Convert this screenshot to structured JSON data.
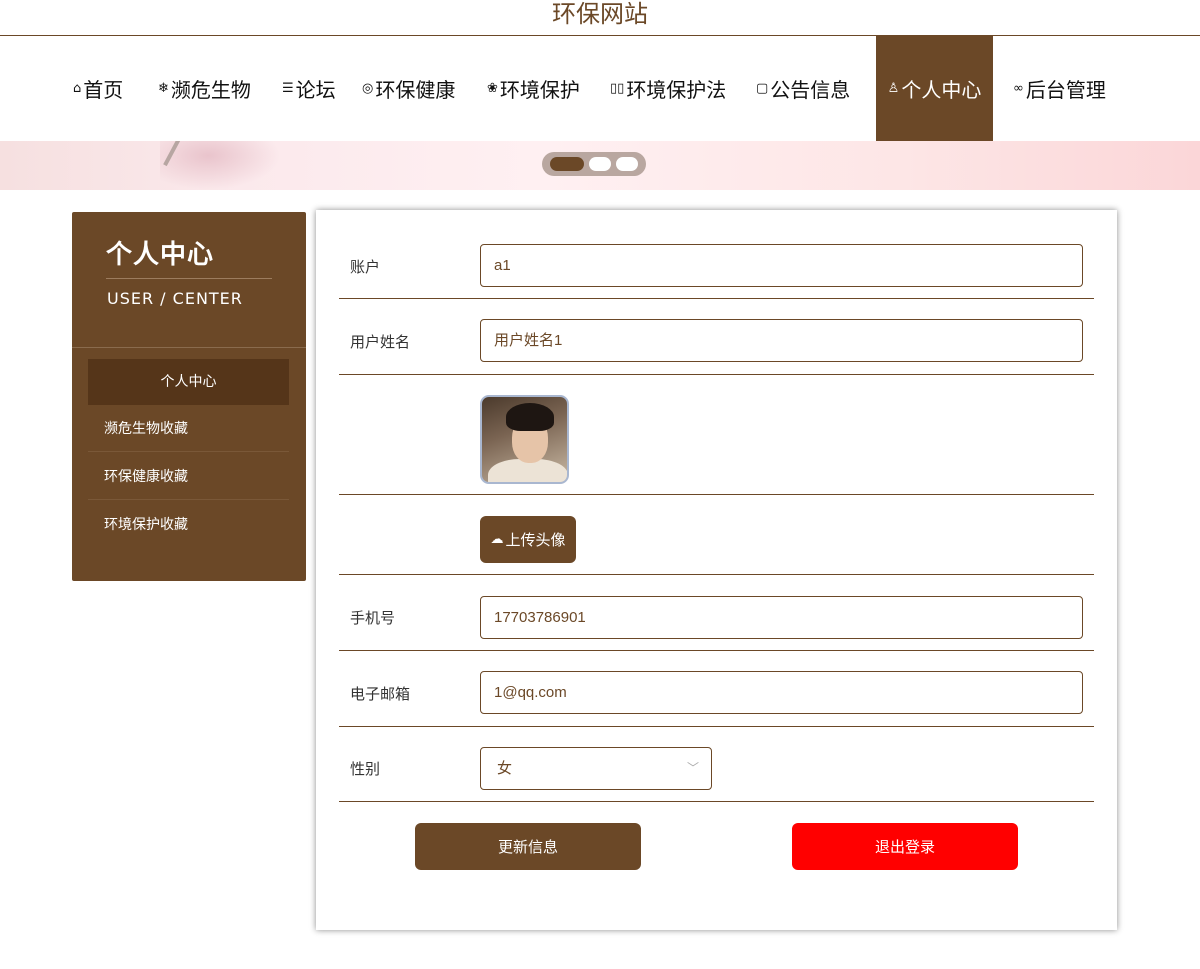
{
  "site": {
    "title": "环保网站"
  },
  "nav": {
    "items": [
      {
        "icon": "home-icon",
        "glyph": "⌂",
        "label": "首页"
      },
      {
        "icon": "snowflake-icon",
        "glyph": "❄",
        "label": "濒危生物"
      },
      {
        "icon": "sliders-icon",
        "glyph": "☰",
        "label": "论坛"
      },
      {
        "icon": "palette-icon",
        "glyph": "◎",
        "label": "环保健康"
      },
      {
        "icon": "leaf-icon",
        "glyph": "❀",
        "label": "环境保护"
      },
      {
        "icon": "book-icon",
        "glyph": "▯▯",
        "label": "环境保护法"
      },
      {
        "icon": "note-icon",
        "glyph": "▢",
        "label": "公告信息"
      },
      {
        "icon": "user-icon",
        "glyph": "♙",
        "label": "个人中心",
        "active": true
      },
      {
        "icon": "link-icon",
        "glyph": "∞",
        "label": "后台管理"
      }
    ]
  },
  "banner": {
    "slides": 3,
    "active_slide": 1
  },
  "sidebar": {
    "title": "个人中心",
    "subtitle": "USER / CENTER",
    "items": [
      {
        "label": "个人中心",
        "active": true
      },
      {
        "label": "濒危生物收藏"
      },
      {
        "label": "环保健康收藏"
      },
      {
        "label": "环境保护收藏"
      }
    ]
  },
  "form": {
    "account": {
      "label": "账户",
      "value": "a1"
    },
    "username": {
      "label": "用户姓名",
      "value": "用户姓名1"
    },
    "upload_label": "上传头像",
    "phone": {
      "label": "手机号",
      "value": "17703786901"
    },
    "email": {
      "label": "电子邮箱",
      "value": "1@qq.com"
    },
    "gender": {
      "label": "性别",
      "value": "女"
    },
    "update_label": "更新信息",
    "logout_label": "退出登录"
  },
  "colors": {
    "brand": "#6b4827",
    "danger": "#ff0000"
  }
}
